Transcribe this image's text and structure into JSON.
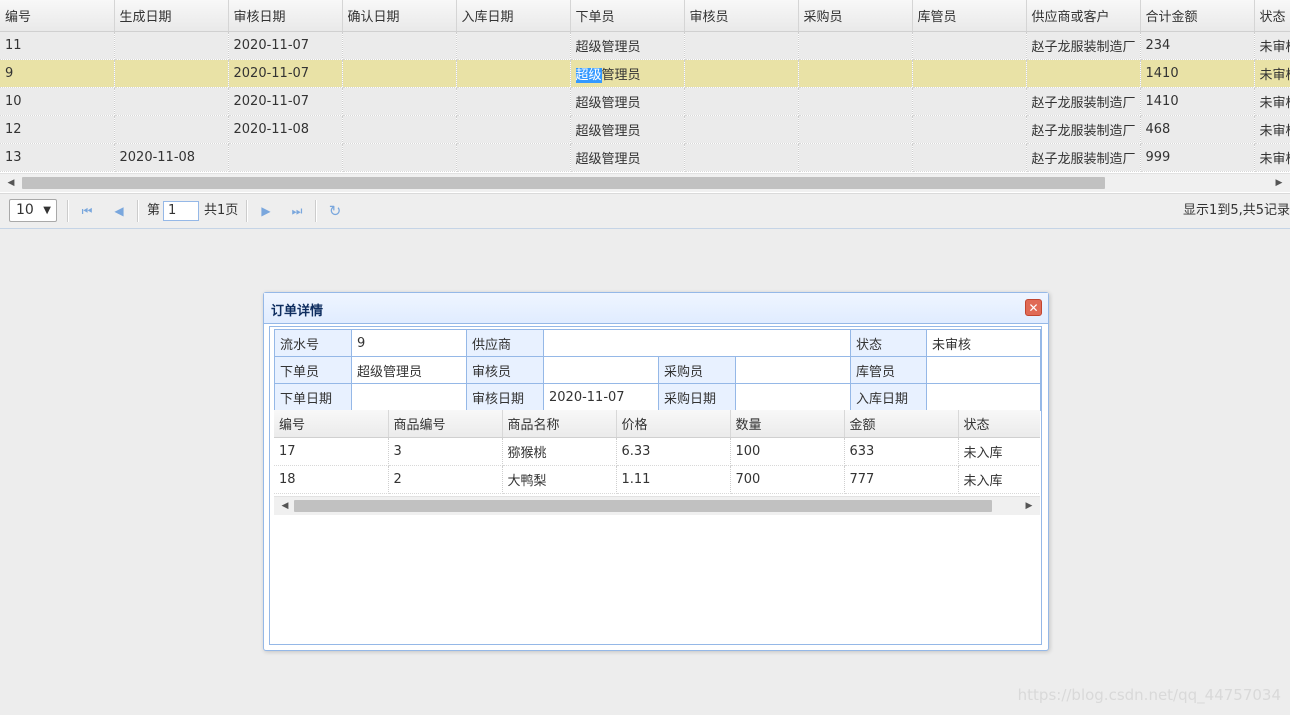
{
  "grid": {
    "columns": [
      "编号",
      "生成日期",
      "审核日期",
      "确认日期",
      "入库日期",
      "下单员",
      "审核员",
      "采购员",
      "库管员",
      "供应商或客户",
      "合计金额",
      "状态"
    ],
    "rows": [
      [
        "11",
        "",
        "2020-11-07",
        "",
        "",
        "超级管理员",
        "",
        "",
        "",
        "赵子龙服装制造厂",
        "234",
        "未审核"
      ],
      [
        "9",
        "",
        "2020-11-07",
        "",
        "",
        "超级管理员",
        "",
        "",
        "",
        "",
        "1410",
        "未审核"
      ],
      [
        "10",
        "",
        "2020-11-07",
        "",
        "",
        "超级管理员",
        "",
        "",
        "",
        "赵子龙服装制造厂",
        "1410",
        "未审核"
      ],
      [
        "12",
        "",
        "2020-11-08",
        "",
        "",
        "超级管理员",
        "",
        "",
        "",
        "赵子龙服装制造厂",
        "468",
        "未审核"
      ],
      [
        "13",
        "2020-11-08",
        "",
        "",
        "",
        "超级管理员",
        "",
        "",
        "",
        "赵子龙服装制造厂",
        "999",
        "未审核"
      ]
    ],
    "selected_row_index": 1,
    "selected_text_highlight": "超级",
    "selected_text_rest": "管理员"
  },
  "pager": {
    "page_size": "10",
    "page_prefix": "第",
    "page_number": "1",
    "page_total": "共1页",
    "display_info": "显示1到5,共5记录"
  },
  "dialog": {
    "title": "订单详情",
    "close_icon": "close-icon",
    "info": {
      "serial_label": "流水号",
      "serial_value": "9",
      "supplier_label": "供应商",
      "supplier_value": "",
      "status_label": "状态",
      "status_value": "未审核",
      "orderer_label": "下单员",
      "orderer_value": "超级管理员",
      "reviewer_label": "审核员",
      "reviewer_value": "",
      "buyer_label": "采购员",
      "buyer_value": "",
      "keeper_label": "库管员",
      "keeper_value": "",
      "order_date_label": "下单日期",
      "order_date_value": "",
      "review_date_label": "审核日期",
      "review_date_value": "2020-11-07",
      "purchase_date_label": "采购日期",
      "purchase_date_value": "",
      "stock_date_label": "入库日期",
      "stock_date_value": ""
    },
    "detail_columns": [
      "编号",
      "商品编号",
      "商品名称",
      "价格",
      "数量",
      "金额",
      "状态"
    ],
    "detail_rows": [
      [
        "17",
        "3",
        "猕猴桃",
        "6.33",
        "100",
        "633",
        "未入库"
      ],
      [
        "18",
        "2",
        "大鸭梨",
        "1.11",
        "700",
        "777",
        "未入库"
      ]
    ]
  },
  "watermark": "https://blog.csdn.net/qq_44757034",
  "colors": {
    "selected_row": "#e9e2a6",
    "dialog_border": "#95b8e7",
    "close_button": "#e06a55",
    "label_cell": "#e8f1ff"
  }
}
